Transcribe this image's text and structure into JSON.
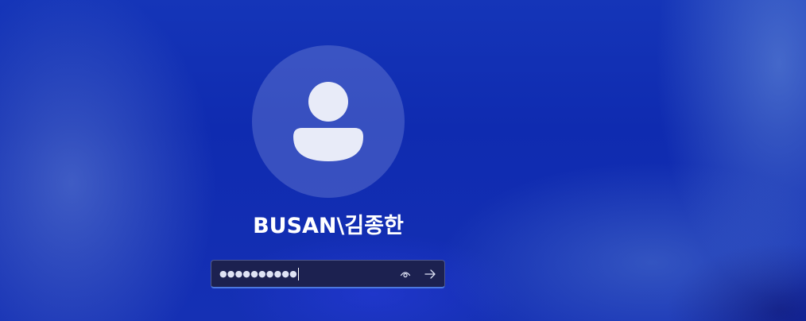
{
  "login": {
    "username": "BUSAN\\김종한",
    "password_masked": "●●●●●●●●●●",
    "reveal_icon": "eye-icon",
    "submit_icon": "arrow-right-icon",
    "avatar_icon": "user-silhouette-icon"
  },
  "colors": {
    "background": "#0f2bb0",
    "avatar_circle": "#3247b8",
    "silhouette": "#e8ebf8",
    "input_background": "#1c2150",
    "input_focus_border": "#4c78e0",
    "text": "#ffffff"
  }
}
